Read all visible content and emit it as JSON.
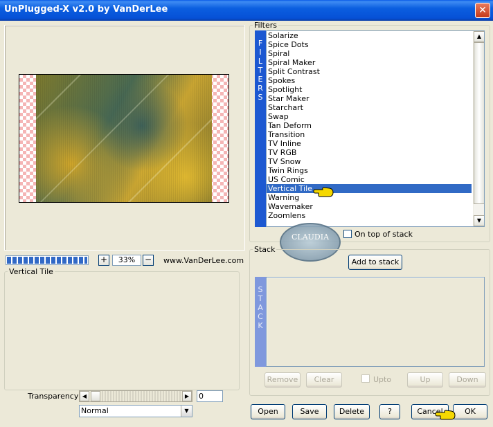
{
  "window": {
    "title": "UnPlugged-X v2.0 by VanDerLee",
    "close_glyph": "✕"
  },
  "preview": {
    "zoom": "33%",
    "zoom_in": "+",
    "zoom_out": "−",
    "website": "www.VanDerLee.com",
    "progress": 1.0
  },
  "params": {
    "group_label": "Vertical Tile",
    "transparency_label": "Transparency",
    "transparency_value": "0",
    "blend_mode": "Normal"
  },
  "filters": {
    "group_label": "Filters",
    "side_label": [
      "F",
      "I",
      "L",
      "T",
      "E",
      "R",
      "S"
    ],
    "items": [
      "Solarize",
      "Spice Dots",
      "Spiral",
      "Spiral Maker",
      "Split Contrast",
      "Spokes",
      "Spotlight",
      "Star Maker",
      "Starchart",
      "Swap",
      "Tan Deform",
      "Transition",
      "TV Inline",
      "TV RGB",
      "TV Snow",
      "Twin Rings",
      "US Comic",
      "Vertical Tile",
      "Warning",
      "Wavemaker",
      "Zoomlens"
    ],
    "selected": "Vertical Tile",
    "on_top_label": "On top of stack"
  },
  "watermark": {
    "text": "CLAUDIA"
  },
  "stack": {
    "group_label": "Stack",
    "side_label": [
      "S",
      "T",
      "A",
      "C",
      "K"
    ],
    "add_label": "Add to stack",
    "remove_label": "Remove",
    "clear_label": "Clear",
    "upto_label": "Upto",
    "up_label": "Up",
    "down_label": "Down"
  },
  "buttons": {
    "open": "Open",
    "save": "Save",
    "delete": "Delete",
    "help": "?",
    "cancel": "Cancel",
    "ok": "OK"
  },
  "colors": {
    "title_blue": "#0650d6",
    "filter_bar": "#1c58d1",
    "stack_bar": "#7f98dd",
    "selection": "#316ac5",
    "pointer_yellow": "#f5d800"
  }
}
